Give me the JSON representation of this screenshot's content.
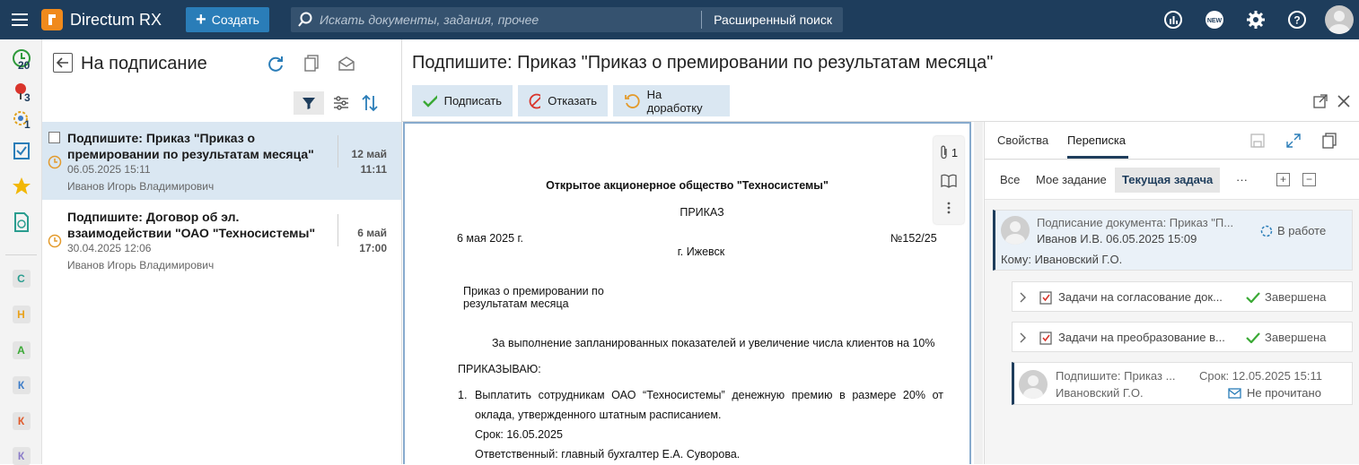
{
  "app": {
    "name": "Directum RX",
    "create_label": "Создать",
    "search_placeholder": "Искать документы, задания, прочее",
    "advanced_search_label": "Расширенный поиск",
    "colors": {
      "topbar": "#1e3d5c",
      "accent": "#2a7db8",
      "logo": "#f08a1c",
      "selected": "#dae7f2"
    },
    "top_icons": [
      "analytics-icon",
      "new-badge-icon",
      "gear-icon",
      "help-icon",
      "user-avatar"
    ],
    "new_badge": "NEW"
  },
  "rail": {
    "items": [
      {
        "icon": "clock-icon",
        "count": "20"
      },
      {
        "icon": "pin-icon",
        "count": "3"
      },
      {
        "icon": "cycle-icon",
        "count": "1"
      },
      {
        "icon": "checklist-icon",
        "count": ""
      },
      {
        "icon": "star-icon",
        "count": ""
      },
      {
        "icon": "document-refresh-icon",
        "count": ""
      }
    ],
    "letters": [
      {
        "letter": "С",
        "color": "#2a9d8f"
      },
      {
        "letter": "Н",
        "color": "#e9a21c"
      },
      {
        "letter": "А",
        "color": "#3aa935"
      },
      {
        "letter": "К",
        "color": "#3a7bc8"
      },
      {
        "letter": "К",
        "color": "#e05a2a"
      },
      {
        "letter": "К",
        "color": "#8a7bc8"
      }
    ]
  },
  "list": {
    "title": "На подписание",
    "tasks": [
      {
        "title": "Подпишите: Приказ \"Приказ о премировании по результатам месяца\"",
        "created": "06.05.2025 15:11",
        "author": "Иванов Игорь Владимирович",
        "date": "12 май",
        "time": "11:11",
        "selected": true
      },
      {
        "title": "Подпишите: Договор об эл. взаимодействии \"ОАО \"Техносистемы\"",
        "created": "30.04.2025 12:06",
        "author": "Иванов Игорь Владимирович",
        "date": "6 май",
        "time": "17:00",
        "selected": false
      }
    ]
  },
  "main": {
    "title": "Подпишите: Приказ \"Приказ о премировании по результатам месяца\"",
    "actions": {
      "sign": "Подписать",
      "reject": "Отказать",
      "rework": "На доработку"
    }
  },
  "doc": {
    "attach_count": "1",
    "company": "Открытое акционерное общество \"Техносистемы\"",
    "type": "ПРИКАЗ",
    "date": "6 мая 2025 г.",
    "number": "№152/25",
    "city": "г. Ижевск",
    "subject_1": "Приказ о премировании по",
    "subject_2": "результатам месяца",
    "preamble": "За выполнение запланированных показателей и увеличение числа клиентов на 10%",
    "order": "ПРИКАЗЫВАЮ:",
    "item_num": "1.",
    "item_line1": "Выплатить сотрудникам ОАО “Техносистемы” денежную премию в размере 20% от",
    "item_line2": "оклада, утвержденного штатным расписанием.",
    "deadline": "Срок: 16.05.2025",
    "responsible": "Ответственный: главный бухгалтер Е.А. Суворова."
  },
  "side": {
    "tabs": {
      "props": "Свойства",
      "correspondence": "Переписка"
    },
    "subtabs": {
      "all": "Все",
      "my_task": "Мое задание",
      "current": "Текущая задача",
      "more": "···"
    },
    "main_card": {
      "subject": "Подписание документа: Приказ \"П...",
      "author_date": "Иванов И.В.   06.05.2025 15:09",
      "status": "В работе",
      "to": "Кому: Ивановский Г.О."
    },
    "group1": {
      "label": "Задачи на согласование док...",
      "status": "Завершена"
    },
    "group2": {
      "label": "Задачи на преобразование в...",
      "status": "Завершена"
    },
    "assign": {
      "subject": "Подпишите: Приказ ...",
      "deadline": "Срок: 12.05.2025 15:11",
      "assignee": "Ивановский Г.О.",
      "status": "Не прочитано"
    }
  }
}
